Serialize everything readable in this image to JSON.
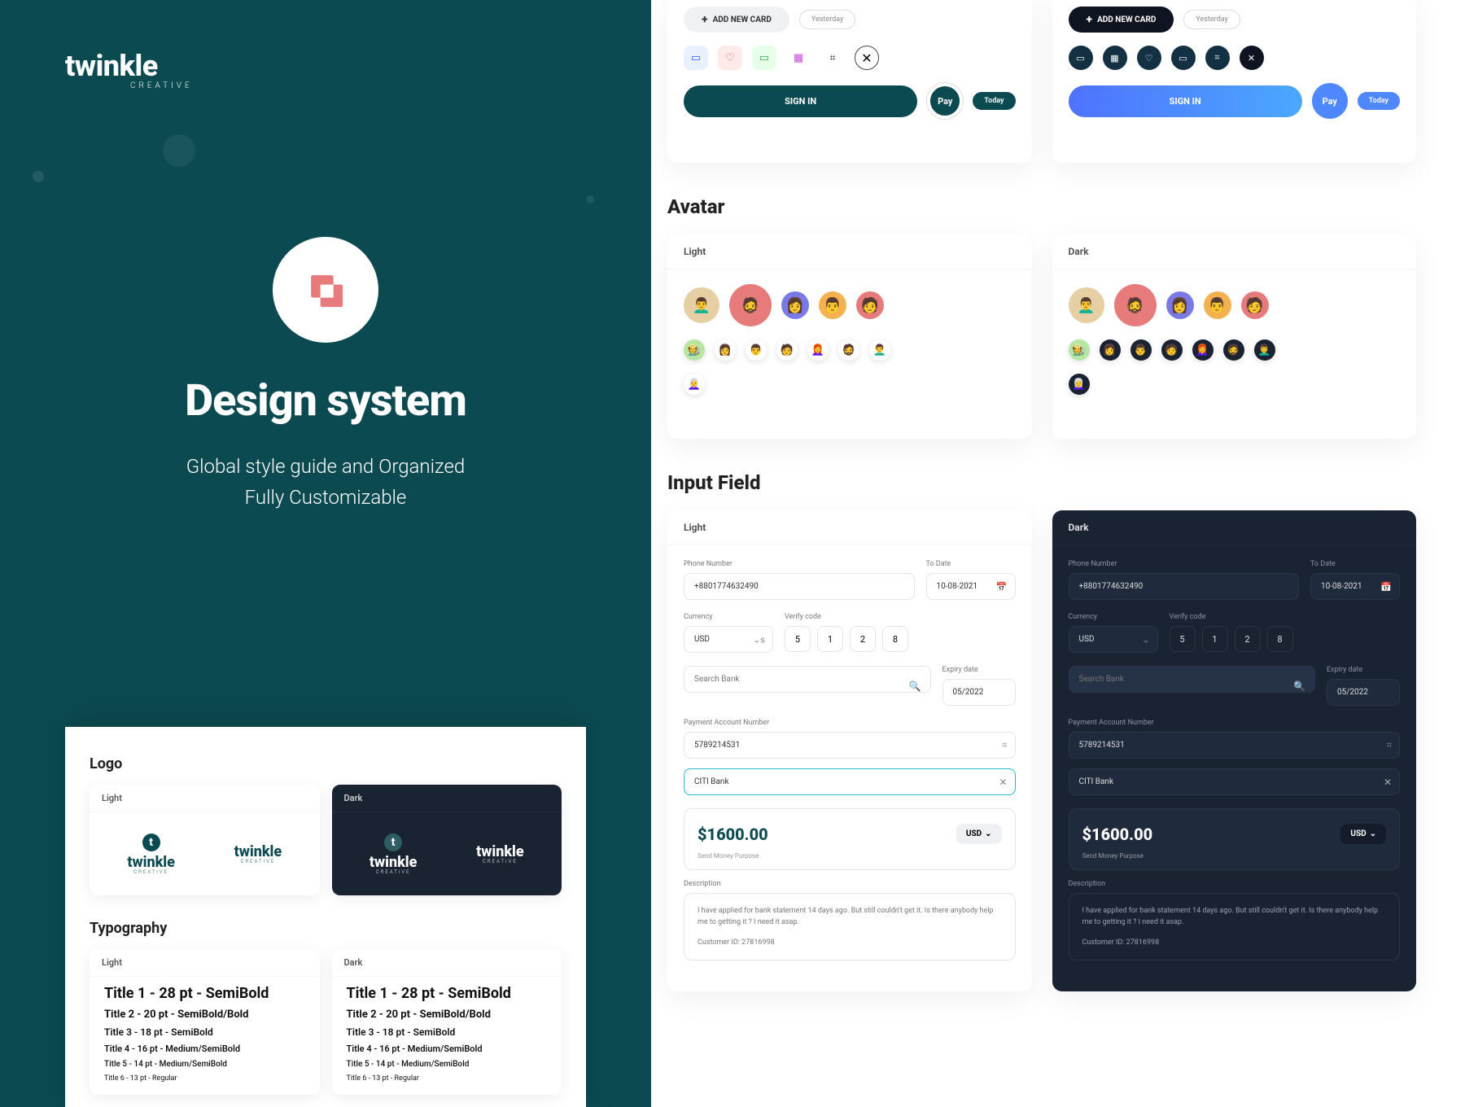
{
  "brand": {
    "name": "twinkle",
    "sub": "CREATIVE"
  },
  "hero": {
    "title": "Design system",
    "subtitle1": "Global style guide and Organized",
    "subtitle2": "Fully Customizable"
  },
  "left_card": {
    "logo_title": "Logo",
    "light": "Light",
    "dark": "Dark",
    "typo_title": "Typography",
    "typo": {
      "t1": "Title 1 - 28 pt - SemiBold",
      "t2": "Title 2 - 20 pt - SemiBold/Bold",
      "t3": "Title  3 - 18 pt - SemiBold",
      "t4": "Title  4 - 16 pt - Medium/SemiBold",
      "t5": "Title  5 - 14 pt - Medium/SemiBold",
      "t6": "Title  6 - 13 pt - Regular"
    }
  },
  "buttons": {
    "add_card": "ADD NEW CARD",
    "yesterday": "Yesterday",
    "signin": "SIGN IN",
    "pay": "Pay",
    "today": "Today"
  },
  "sections": {
    "avatar": "Avatar",
    "input": "Input Field",
    "light": "Light",
    "dark": "Dark"
  },
  "input": {
    "phone_label": "Phone Number",
    "phone_value": "+8801774632490",
    "todate_label": "To Date",
    "todate_value": "10-08-2021",
    "currency_label": "Currency",
    "currency_value": "USD",
    "verify_label": "Verify code",
    "code": [
      "5",
      "1",
      "2",
      "8"
    ],
    "search_placeholder": "Search Bank",
    "expiry_label": "Expiry date",
    "expiry_value": "05/2022",
    "account_label": "Payment Account Number",
    "account_value": "5789214531",
    "bank_value": "CITI Bank",
    "amount": "$1600.00",
    "amount_currency": "USD",
    "amount_note": "Send Money Purpose",
    "desc_label": "Description",
    "desc_text": "I have applied for bank statement 14 days ago. But still couldn't get it. Is there anybody help me to getting it ? I need it asap.",
    "customer_id": "Customer ID: 27816998"
  }
}
